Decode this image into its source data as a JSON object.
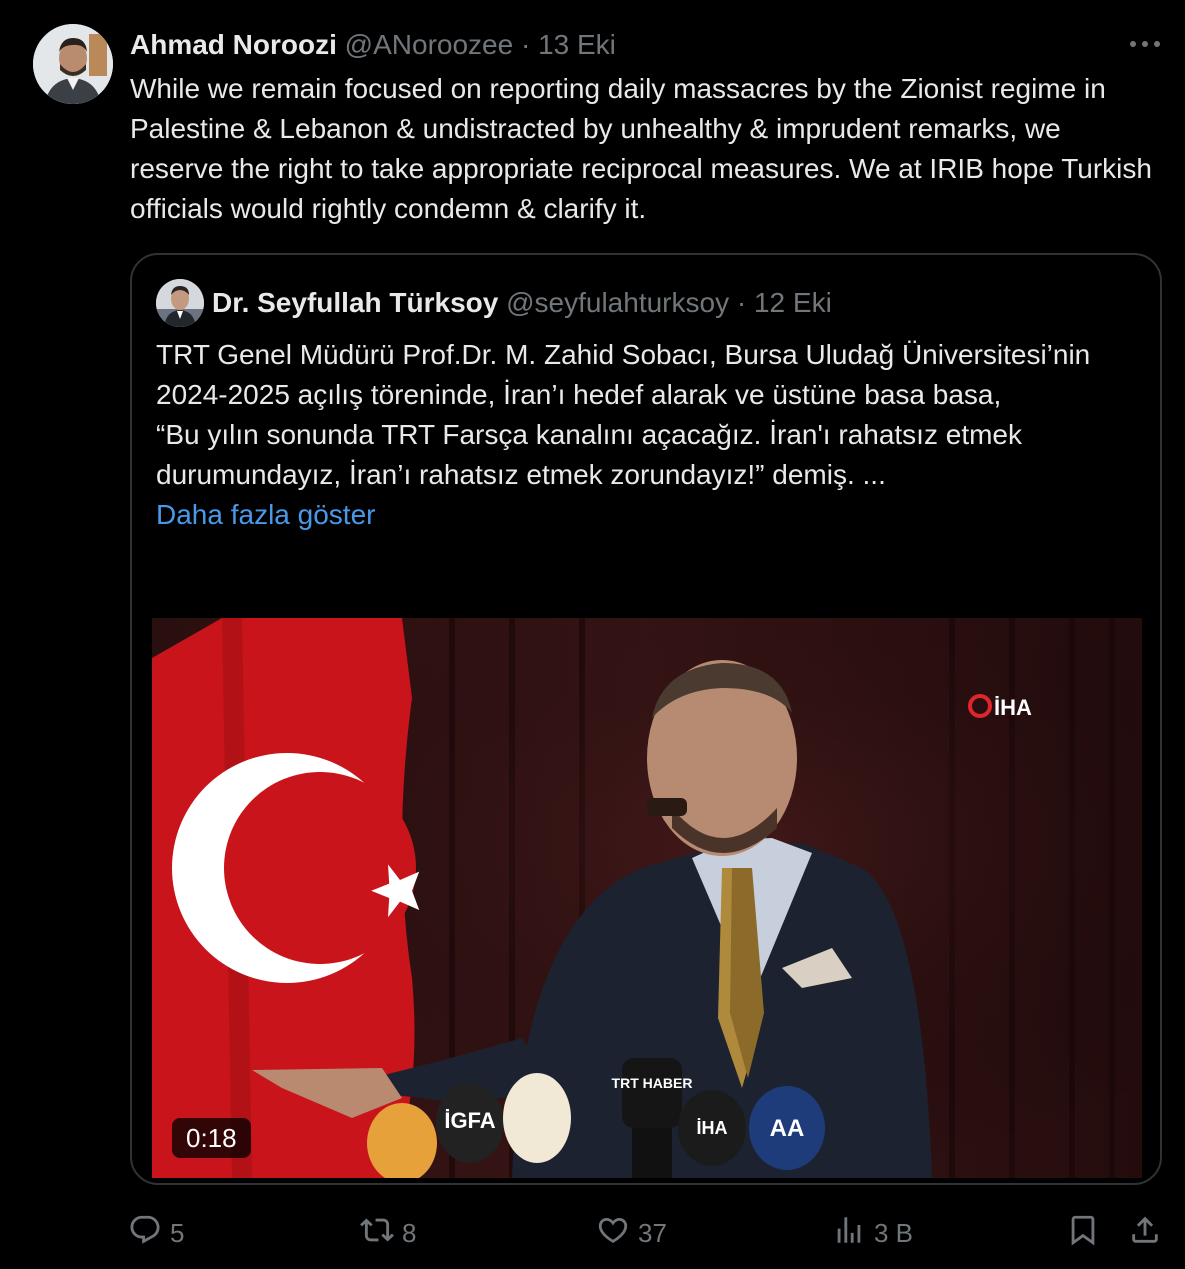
{
  "tweet": {
    "author_name": "Ahmad Noroozi",
    "author_handle": "@ANoroozee",
    "separator": " · ",
    "date": "13 Eki",
    "text": "While we remain focused on reporting daily massacres by the Zionist regime in Palestine & Lebanon & undistracted by unhealthy & imprudent remarks, we reserve the right to take appropriate reciprocal measures. We at IRIB hope Turkish officials would rightly condemn & clarify it."
  },
  "quote": {
    "author_name": "Dr. Seyfullah Türksoy",
    "author_handle": "@seyfulahturksoy",
    "separator": " · ",
    "date": "12 Eki",
    "text_line1": "TRT Genel Müdürü Prof.Dr. M. Zahid Sobacı, Bursa Uludağ Üniversitesi’nin 2024-2025 açılış töreninde, İran’ı hedef alarak ve üstüne basa basa,",
    "text_line2": "“Bu yılın sonunda TRT Farsça kanalını açacağız. İran'ı rahatsız etmek durumundayız, İran’ı rahatsız etmek zorundayız!” demiş. ...",
    "show_more": "Daha fazla göster",
    "video": {
      "duration": "0:18",
      "watermark": "İHA",
      "mic_labels": [
        "TRT HABER",
        "İGFA",
        "AA",
        "İHA"
      ]
    }
  },
  "actions": {
    "replies": "5",
    "reposts": "8",
    "likes": "37",
    "views": "3 B"
  },
  "colors": {
    "background": "#000000",
    "text": "#e7e9ea",
    "muted": "#71767b",
    "link": "#4a99e9",
    "border": "#2f3336"
  },
  "icons": [
    "more-icon",
    "reply-icon",
    "repost-icon",
    "like-icon",
    "views-icon",
    "bookmark-icon",
    "share-icon"
  ]
}
